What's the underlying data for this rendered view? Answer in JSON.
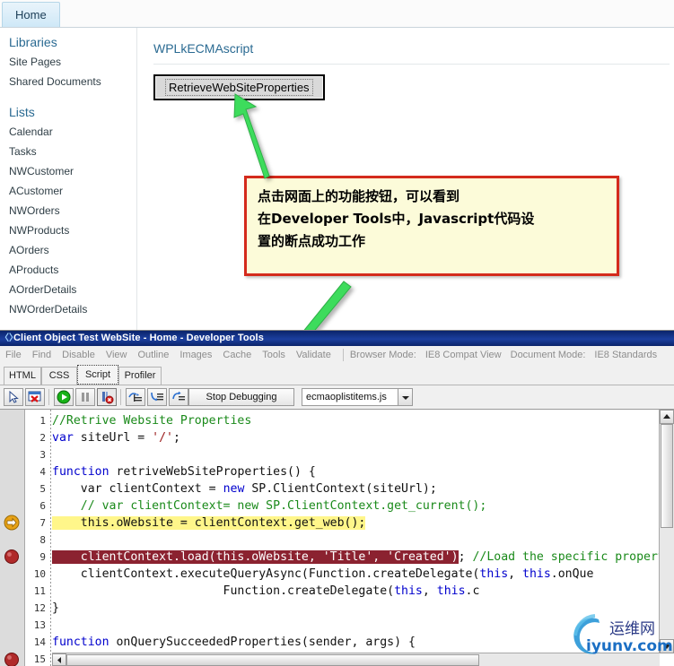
{
  "sharepoint": {
    "tab": "Home",
    "sidebar": [
      {
        "label": "Libraries",
        "type": "head"
      },
      {
        "label": "Site Pages",
        "type": "link"
      },
      {
        "label": "Shared Documents",
        "type": "link"
      },
      {
        "label": "Lists",
        "type": "head"
      },
      {
        "label": "Calendar",
        "type": "link"
      },
      {
        "label": "Tasks",
        "type": "link"
      },
      {
        "label": "NWCustomer",
        "type": "link"
      },
      {
        "label": "ACustomer",
        "type": "link"
      },
      {
        "label": "NWOrders",
        "type": "link"
      },
      {
        "label": "NWProducts",
        "type": "link"
      },
      {
        "label": "AOrders",
        "type": "link"
      },
      {
        "label": "AProducts",
        "type": "link"
      },
      {
        "label": "AOrderDetails",
        "type": "link"
      },
      {
        "label": "NWOrderDetails",
        "type": "link"
      }
    ],
    "webpart_title": "WPLkECMAscript",
    "action_button": "RetrieveWebSiteProperties"
  },
  "callout": {
    "line1": "点击网面上的功能按钮，可以看到",
    "line2": "在Developer Tools中，Javascript代码设",
    "line3": "置的断点成功工作",
    "border_color": "#d42a1c",
    "background_color": "#fcfbd9"
  },
  "devtools": {
    "title": "Client Object Test WebSite - Home - Developer Tools",
    "menu": [
      "File",
      "Find",
      "Disable",
      "View",
      "Outline",
      "Images",
      "Cache",
      "Tools",
      "Validate"
    ],
    "browser_mode_label": "Browser Mode:",
    "browser_mode_value": "IE8 Compat View",
    "document_mode_label": "Document Mode:",
    "document_mode_value": "IE8 Standards",
    "tabs": [
      {
        "label": "HTML",
        "selected": false
      },
      {
        "label": "CSS",
        "selected": false
      },
      {
        "label": "Script",
        "selected": true
      },
      {
        "label": "Profiler",
        "selected": false
      }
    ],
    "toolbar": {
      "select_element": "select-element-icon",
      "clear_browser_cache": "clear-browser-cache-icon",
      "continue": "continue-run-icon",
      "break_all": "break-all-icon",
      "stop_debug_icon": "stop-debugging-icon",
      "step_into": "step-into-icon",
      "step_over": "step-over-icon",
      "step_out": "step-out-icon",
      "stop_debugging_label": "Stop Debugging",
      "script_file": "ecmaoplistitems.js"
    },
    "code": {
      "lines": [
        {
          "n": "1",
          "segments": [
            {
              "t": "//Retrive Website Properties",
              "c": "k-green"
            }
          ]
        },
        {
          "n": "2",
          "segments": [
            {
              "t": "var",
              "c": "k-blue"
            },
            {
              "t": " siteUrl = ",
              "c": "k-black"
            },
            {
              "t": "'/'",
              "c": "k-red"
            },
            {
              "t": ";",
              "c": "k-black"
            }
          ]
        },
        {
          "n": "3",
          "segments": []
        },
        {
          "n": "4",
          "segments": [
            {
              "t": "function",
              "c": "k-blue"
            },
            {
              "t": " retriveWebSiteProperties() {",
              "c": "k-black"
            }
          ]
        },
        {
          "n": "5",
          "segments": [
            {
              "t": "    var clientContext = ",
              "c": "k-black"
            },
            {
              "t": "new",
              "c": "k-blue"
            },
            {
              "t": " SP.ClientContext(siteUrl);",
              "c": "k-black"
            }
          ]
        },
        {
          "n": "6",
          "segments": [
            {
              "t": "    // var clientContext= new SP.ClientContext.get_current();",
              "c": "k-green"
            }
          ]
        },
        {
          "n": "7",
          "segments": [
            {
              "t": "    this.oWebsite = clientContext.get_web();",
              "c": "k-black hl-current"
            }
          ]
        },
        {
          "n": "8",
          "segments": []
        },
        {
          "n": "9",
          "segments": [
            {
              "t": "    clientContext.load(this.oWebsite, 'Title', 'Created')",
              "c": "hl-break"
            },
            {
              "t": "; ",
              "c": "k-black"
            },
            {
              "t": "//Load the specific propertie",
              "c": "k-green"
            }
          ]
        },
        {
          "n": "10",
          "segments": [
            {
              "t": "    clientContext.executeQueryAsync(Function.createDelegate(",
              "c": "k-black"
            },
            {
              "t": "this",
              "c": "k-blue"
            },
            {
              "t": ", ",
              "c": "k-black"
            },
            {
              "t": "this",
              "c": "k-blue"
            },
            {
              "t": ".onQue",
              "c": "k-black"
            }
          ]
        },
        {
          "n": "11",
          "segments": [
            {
              "t": "                        Function.createDelegate(",
              "c": "k-black"
            },
            {
              "t": "this",
              "c": "k-blue"
            },
            {
              "t": ", ",
              "c": "k-black"
            },
            {
              "t": "this",
              "c": "k-blue"
            },
            {
              "t": ".c",
              "c": "k-black"
            }
          ]
        },
        {
          "n": "12",
          "segments": [
            {
              "t": "}",
              "c": "k-black"
            }
          ]
        },
        {
          "n": "13",
          "segments": []
        },
        {
          "n": "14",
          "segments": [
            {
              "t": "function",
              "c": "k-blue"
            },
            {
              "t": " onQuerySucceededProperties(sender, args) {",
              "c": "k-black"
            }
          ]
        },
        {
          "n": "15",
          "segments": []
        }
      ],
      "current_line": "7",
      "breakpoint_line": "9"
    }
  },
  "watermark": {
    "cn": "运维网",
    "en": "iyunv.com"
  }
}
